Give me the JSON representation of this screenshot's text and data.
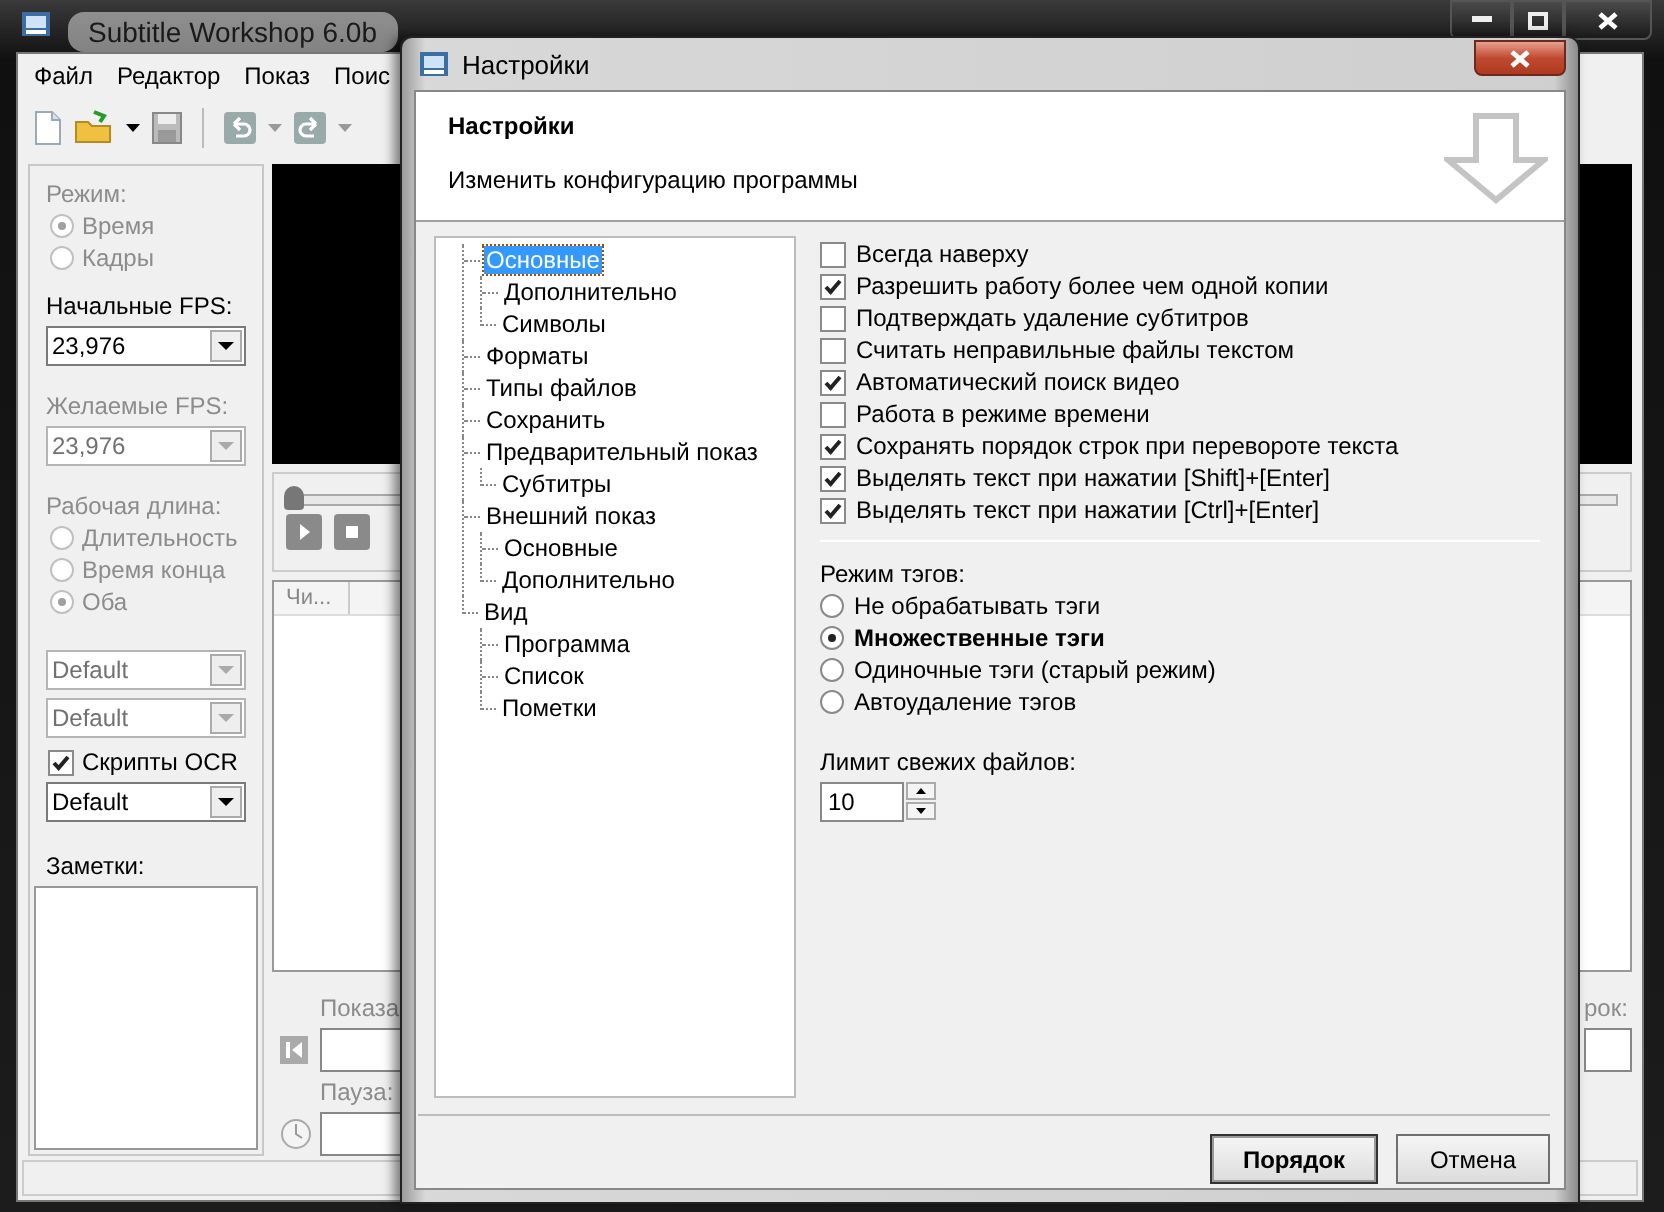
{
  "main_window": {
    "title": "Subtitle Workshop 6.0b",
    "menu": [
      "Файл",
      "Редактор",
      "Показ",
      "Поис"
    ],
    "left_panel": {
      "mode": {
        "label": "Режим:",
        "disabled": true,
        "options": [
          {
            "label": "Время",
            "selected": true
          },
          {
            "label": "Кадры",
            "selected": false
          }
        ]
      },
      "input_fps": {
        "label": "Начальные FPS:",
        "value": "23,976",
        "disabled": false
      },
      "target_fps": {
        "label": "Желаемые FPS:",
        "value": "23,976",
        "disabled": true
      },
      "work_length": {
        "label": "Рабочая длина:",
        "disabled": true,
        "options": [
          {
            "label": "Длительность",
            "selected": false
          },
          {
            "label": "Время конца",
            "selected": false
          },
          {
            "label": "Оба",
            "selected": true
          }
        ]
      },
      "selects": [
        {
          "value": "Default",
          "disabled": true
        },
        {
          "value": "Default",
          "disabled": true
        }
      ],
      "ocr_scripts": {
        "label": "Скрипты OCR",
        "checked": true
      },
      "ocr_select": {
        "value": "Default",
        "disabled": false
      },
      "notes": {
        "label": "Заметки:"
      }
    },
    "seek": {
      "level": 0
    },
    "subtitle_list": {
      "columns": [
        "Чи..."
      ]
    },
    "bottom": {
      "disabled": true,
      "show_label": "Показа",
      "pause_label": "Пауза:",
      "right_label": "рок:"
    }
  },
  "dialog": {
    "title": "Настройки",
    "header": {
      "title": "Настройки",
      "subtitle": "Изменить конфигурацию программы"
    },
    "tree": [
      {
        "label": "Основные",
        "selected": true,
        "children": [
          {
            "label": "Дополнительно",
            "selected": false
          },
          {
            "label": "Символы",
            "selected": false
          }
        ]
      },
      {
        "label": "Форматы",
        "selected": false
      },
      {
        "label": "Типы файлов",
        "selected": false
      },
      {
        "label": "Сохранить",
        "selected": false
      },
      {
        "label": "Предварительный показ",
        "selected": false,
        "children": [
          {
            "label": "Субтитры",
            "selected": false
          }
        ]
      },
      {
        "label": "Внешний показ",
        "selected": false,
        "children": [
          {
            "label": "Основные",
            "selected": false
          },
          {
            "label": "Дополнительно",
            "selected": false
          }
        ]
      },
      {
        "label": "Вид",
        "selected": false,
        "children": [
          {
            "label": "Программа",
            "selected": false
          },
          {
            "label": "Список",
            "selected": false
          },
          {
            "label": "Пометки",
            "selected": false
          }
        ]
      }
    ],
    "options": [
      {
        "label": "Всегда наверху",
        "checked": false
      },
      {
        "label": "Разрешить работу более чем одной копии",
        "checked": true
      },
      {
        "label": "Подтверждать удаление субтитров",
        "checked": false
      },
      {
        "label": "Считать неправильные файлы текстом",
        "checked": false
      },
      {
        "label": "Автоматический поиск видео",
        "checked": true
      },
      {
        "label": "Работа в режиме времени",
        "checked": false
      },
      {
        "label": "Сохранять порядок строк при перевороте текста",
        "checked": true
      },
      {
        "label": "Выделять текст при нажатии [Shift]+[Enter]",
        "checked": true
      },
      {
        "label": "Выделять текст при нажатии [Ctrl]+[Enter]",
        "checked": true
      }
    ],
    "tag_mode": {
      "label": "Режим тэгов:",
      "options": [
        {
          "label": "Не обрабатывать тэги",
          "selected": false
        },
        {
          "label": "Множественные тэги",
          "selected": true
        },
        {
          "label": "Одиночные тэги (старый режим)",
          "selected": false
        },
        {
          "label": "Автоудаление тэгов",
          "selected": false
        }
      ]
    },
    "recent_limit": {
      "label": "Лимит свежих файлов:",
      "value": "10"
    },
    "buttons": [
      {
        "label": "Порядок",
        "default": true
      },
      {
        "label": "Отмена",
        "default": false
      }
    ]
  }
}
